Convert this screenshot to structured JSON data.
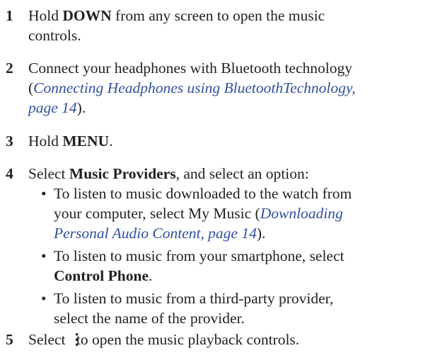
{
  "steps": [
    {
      "number": "1",
      "pre": "Hold ",
      "bold": "DOWN",
      "post": " from any screen to open the music",
      "line2": "controls."
    },
    {
      "number": "2",
      "line1": "Connect your headphones with Bluetooth technology",
      "open_paren": "(",
      "link_line1": "Connecting Headphones using BluetoothTechnology,",
      "link_line2": "page 14",
      "close": ")."
    },
    {
      "number": "3",
      "pre": "Hold ",
      "bold": "MENU",
      "post": "."
    },
    {
      "number": "4",
      "pre": "Select ",
      "bold": "Music Providers",
      "post": ", and select an option:"
    },
    {
      "number": "5",
      "pre": "Select ",
      "glyph": "⋮",
      "post": "to open the music playback controls."
    }
  ],
  "bullets": [
    {
      "dot": "•",
      "line1": "To listen to music downloaded to the watch from",
      "line2_pre": "your computer, select My Music (",
      "line2_link": "Downloading",
      "line3_link": "Personal Audio Content, page 14",
      "line3_post": ")."
    },
    {
      "dot": "•",
      "line1": "To listen to music from your smartphone, select",
      "line2_bold": "Control Phone",
      "line2_post": "."
    },
    {
      "dot": "•",
      "line1": "To listen to music from a third-party provider,",
      "line2": "select the name of the provider."
    }
  ]
}
